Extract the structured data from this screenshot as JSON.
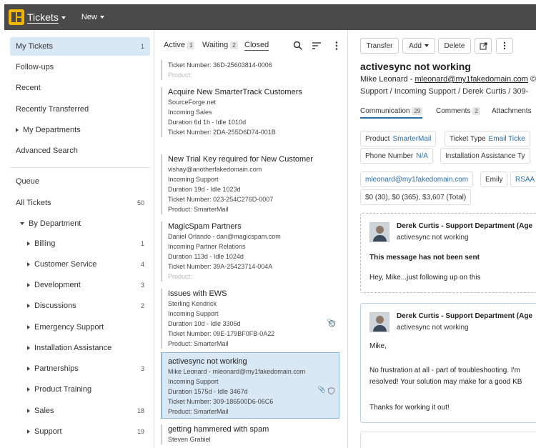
{
  "topbar": {
    "app_title": "Tickets",
    "new_label": "New"
  },
  "sidebar": {
    "items": [
      {
        "label": "My Tickets",
        "count": "1"
      },
      {
        "label": "Follow-ups",
        "count": ""
      },
      {
        "label": "Recent",
        "count": ""
      },
      {
        "label": "Recently Transferred",
        "count": ""
      },
      {
        "label": "My Departments",
        "count": ""
      },
      {
        "label": "Advanced Search",
        "count": ""
      },
      {
        "label": "Queue",
        "count": ""
      },
      {
        "label": "All Tickets",
        "count": "50"
      },
      {
        "label": "By Department",
        "count": ""
      }
    ],
    "departments": [
      {
        "label": "Billing",
        "count": "1"
      },
      {
        "label": "Customer Service",
        "count": "4"
      },
      {
        "label": "Development",
        "count": "3"
      },
      {
        "label": "Discussions",
        "count": "2"
      },
      {
        "label": "Emergency Support",
        "count": ""
      },
      {
        "label": "Installation Assistance",
        "count": ""
      },
      {
        "label": "Partnerships",
        "count": "3"
      },
      {
        "label": "Product Training",
        "count": ""
      },
      {
        "label": "Sales",
        "count": "18"
      },
      {
        "label": "Support",
        "count": "19"
      }
    ]
  },
  "list": {
    "tabs": [
      {
        "label": "Active",
        "count": "1"
      },
      {
        "label": "Waiting",
        "count": "2"
      },
      {
        "label": "Closed",
        "count": ""
      }
    ],
    "tickets": [
      {
        "title": "",
        "lines": [
          "Ticket Number: 36D-25603814-0006",
          "Product:"
        ]
      },
      {
        "title": "Acquire New SmarterTrack Customers",
        "lines": [
          "SourceForge.net",
          "Incoming Sales",
          "Duration 6d 1h  -  Idle 1010d",
          "Ticket Number: 2DA-255D6D74-001B"
        ]
      },
      {
        "title": "New Trial Key required for New Customer",
        "lines": [
          "vishay@anotherfakedomain.com",
          "Incoming Support",
          "Duration 19d  -  Idle 1023d",
          "Ticket Number: 023-254C276D-0007",
          "Product: SmarterMail"
        ]
      },
      {
        "title": "MagicSpam Partners",
        "lines": [
          "Daniel Orlando - dan@magicspam.com",
          "Incoming Partner Relations",
          "Duration 113d  -  Idle 1024d",
          "Ticket Number: 39A-25423714-004A",
          "Product:"
        ]
      },
      {
        "title": "Issues with EWS",
        "lines": [
          "Sterling Kendrick",
          "Incoming Support",
          "Duration 10d  -  Idle 3306d",
          "Ticket Number: 09E-179BF0FB-0A22",
          "Product: SmarterMail"
        ]
      },
      {
        "title": "activesync not working",
        "lines": [
          "Mike Leonard -  mleonard@my1fakedomain.com",
          "Incoming Support",
          "Duration 1575d  -  Idle 3467d",
          "Ticket Number: 309-186500D6-06C6",
          "Product: SmarterMail"
        ]
      },
      {
        "title": "getting hammered with spam",
        "lines": [
          "Steven Grabiel"
        ]
      }
    ]
  },
  "detail": {
    "buttons": {
      "transfer": "Transfer",
      "add": "Add",
      "delete": "Delete"
    },
    "subject": "activesync not working",
    "from_name": "Mike Leonard -",
    "from_email": "mleonard@my1fakedomain.com",
    "path": "Support  /  Incoming Support  /  Derek Curtis  /  309-",
    "tabs": [
      {
        "label": "Communication",
        "count": "29"
      },
      {
        "label": "Comments",
        "count": "2"
      },
      {
        "label": "Attachments",
        "count": ""
      }
    ],
    "chips": {
      "product_label": "Product",
      "product_value": "SmarterMail",
      "ticket_type_label": "Ticket Type",
      "ticket_type_value": "Email Ticke",
      "phone_label": "Phone Number",
      "phone_value": "N/A",
      "install_label": "Installation Assistance Ty",
      "email": "mleonard@my1fakedomain.com",
      "emily": "Emily",
      "rsa": "RSAA",
      "totals": "$0 (30), $0 (365), $3,607 (Total)"
    },
    "messages": [
      {
        "sender": "Derek Curtis - Support Department  (Age",
        "subject": "activesync not working",
        "notice": "This message has not been sent",
        "body": [
          "Hey, Mike...just following up on this"
        ]
      },
      {
        "sender": "Derek Curtis - Support Department  (Age",
        "subject": "activesync not working",
        "notice": "",
        "body": [
          "Mike,",
          "No frustration at all - part of troubleshooting. I'm",
          "resolved! Your solution may make for a good KB",
          "Thanks for working it out!"
        ]
      }
    ]
  }
}
